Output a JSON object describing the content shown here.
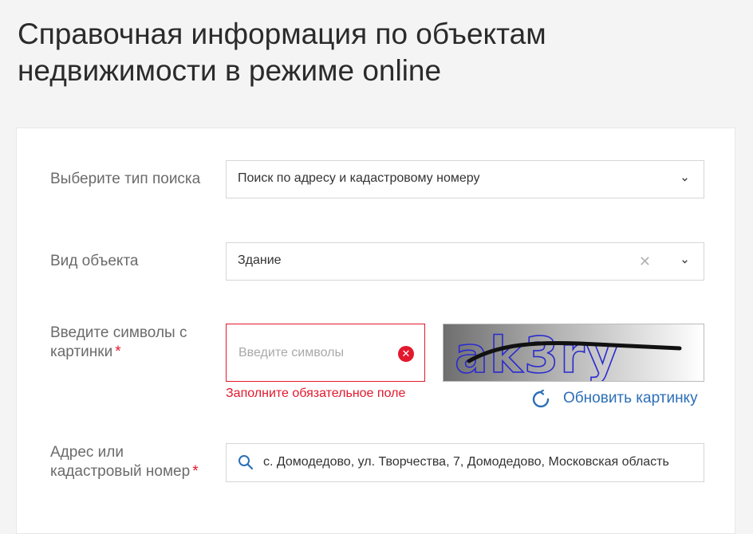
{
  "page": {
    "title": "Справочная информация по объектам недвижимости в режиме online"
  },
  "form": {
    "search_type": {
      "label": "Выберите тип поиска",
      "value": "Поиск по адресу и кадастровому номеру",
      "icon": "chevron-down-icon"
    },
    "object_type": {
      "label": "Вид объекта",
      "value": "Здание",
      "clear_icon": "close-icon",
      "clear_glyph": "✕",
      "icon": "chevron-down-icon"
    },
    "captcha": {
      "label": "Введите символы с картинки",
      "required_mark": "*",
      "placeholder": "Введите символы",
      "error_icon_glyph": "✕",
      "error": "Заполните обязательное поле",
      "image_text": "ak3ry",
      "refresh_label": "Обновить картинку",
      "refresh_icon": "refresh-icon"
    },
    "address": {
      "label": "Адрес или кадастровый номер",
      "required_mark": "*",
      "value": "с. Домодедово, ул. Творчества, 7, Домодедово, Московская область",
      "icon": "search-icon"
    }
  },
  "colors": {
    "error": "#e3182d",
    "link": "#2c6fb6",
    "border": "#d6d6d6"
  }
}
